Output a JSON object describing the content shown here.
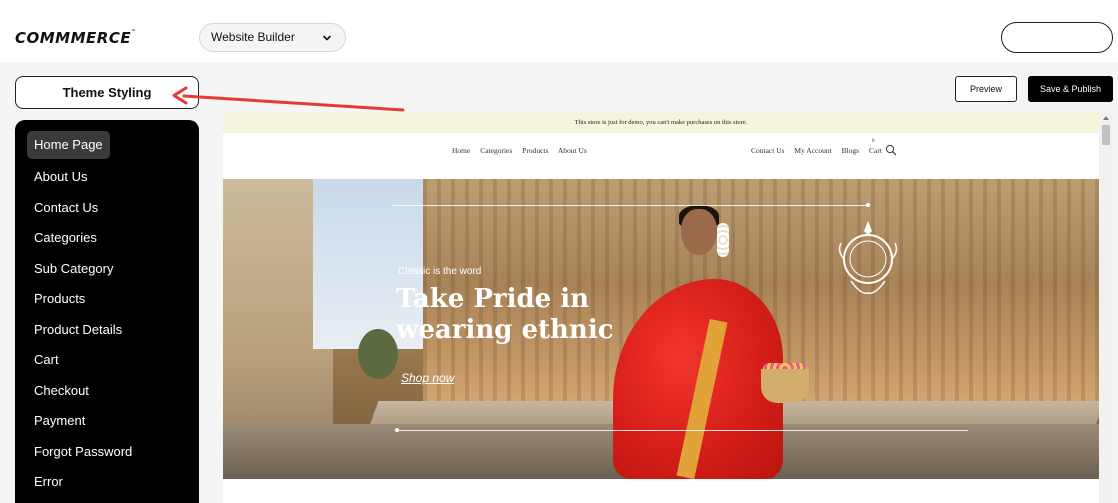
{
  "app": {
    "logo_text": "COMMMERCE",
    "logo_tm": "™"
  },
  "header": {
    "builder_select": {
      "value": "Website Builder",
      "icon": "chevron-down-icon"
    }
  },
  "toolbar": {
    "theme_styling_label": "Theme Styling",
    "preview_label": "Preview",
    "publish_label": "Save & Publish"
  },
  "sidebar": {
    "items": [
      {
        "label": "Home Page",
        "active": true
      },
      {
        "label": "About Us"
      },
      {
        "label": "Contact Us"
      },
      {
        "label": "Categories"
      },
      {
        "label": "Sub Category"
      },
      {
        "label": "Products"
      },
      {
        "label": "Product Details"
      },
      {
        "label": "Cart"
      },
      {
        "label": "Checkout"
      },
      {
        "label": "Payment"
      },
      {
        "label": "Forgot Password"
      },
      {
        "label": "Error"
      }
    ]
  },
  "preview": {
    "demo_notice": "This store is just for demo, you can't make purchases on this store.",
    "nav_left": [
      "Home",
      "Categories",
      "Products",
      "About Us"
    ],
    "nav_right": [
      "Contact Us",
      "My Account",
      "Blogs",
      "Cart"
    ],
    "cart_count": "0",
    "hero": {
      "tagline": "Classic is the word",
      "title_line1": "Take Pride in",
      "title_line2": "wearing ethnic",
      "cta": "Shop now"
    }
  },
  "annotation": {
    "arrow_color": "#e53935"
  },
  "colors": {
    "sidebar_bg": "#000000",
    "sidebar_active": "#3a3a3a",
    "demo_bar": "#f5f5dc",
    "publish_bg": "#000000"
  }
}
